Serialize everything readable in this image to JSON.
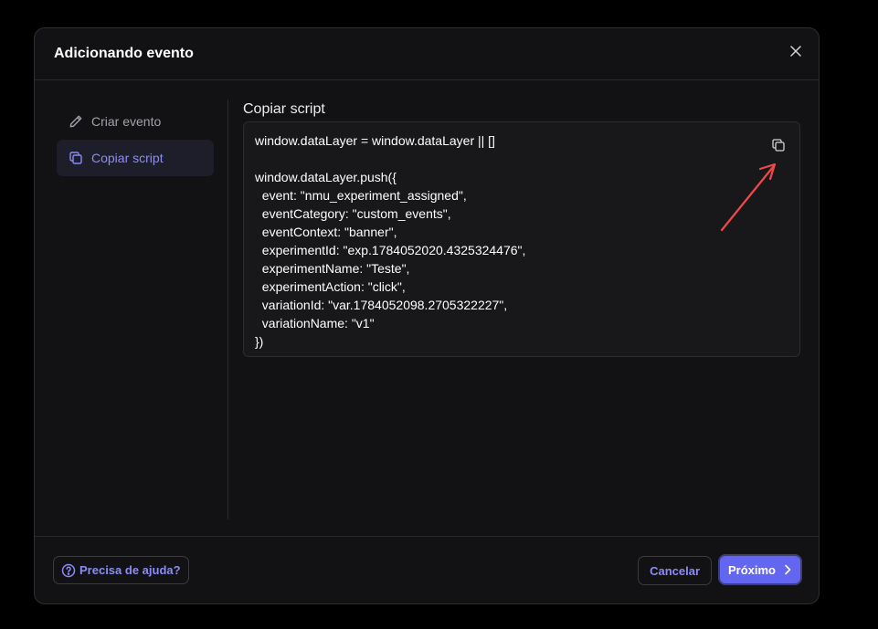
{
  "modal": {
    "title": "Adicionando evento"
  },
  "sidebar": {
    "items": [
      {
        "label": "Criar evento",
        "icon": "pencil-icon",
        "active": false
      },
      {
        "label": "Copiar script",
        "icon": "copy-icon",
        "active": true
      }
    ]
  },
  "content": {
    "section_title": "Copiar script",
    "code_lines": [
      "window.dataLayer = window.dataLayer || []",
      "",
      "window.dataLayer.push({",
      "  event: \"nmu_experiment_assigned\",",
      "  eventCategory: \"custom_events\",",
      "  eventContext: \"banner\",",
      "  experimentId: \"exp.1784052020.4325324476\",",
      "  experimentName: \"Teste\",",
      "  experimentAction: \"click\",",
      "  variationId: \"var.1784052098.2705322227\",",
      "  variationName: \"v1\"",
      "})"
    ]
  },
  "footer": {
    "help_label": "Precisa de ajuda?",
    "cancel_label": "Cancelar",
    "next_label": "Próximo"
  },
  "colors": {
    "accent": "#6366f1",
    "accent_text": "#8b8cf5",
    "annotation_arrow": "#f04848"
  }
}
